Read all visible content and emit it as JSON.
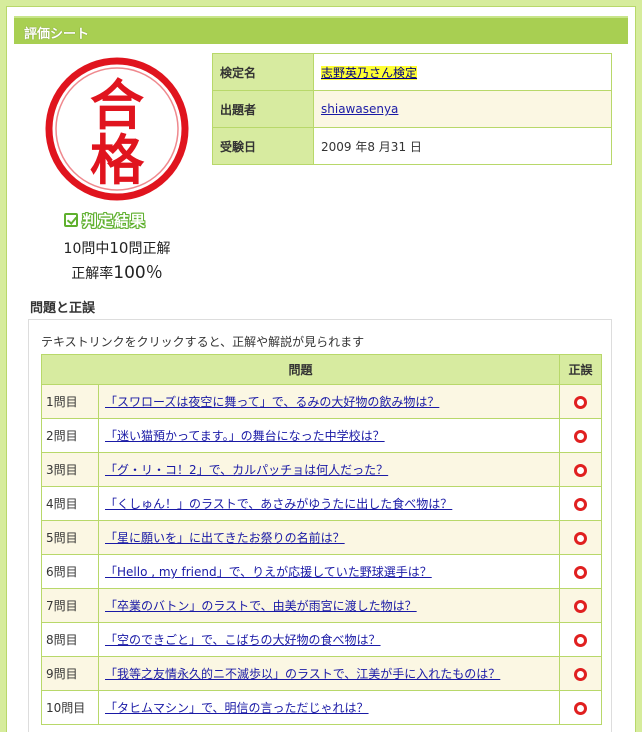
{
  "header": {
    "title": "評価シート"
  },
  "stamp": {
    "line1": "合",
    "line2": "格",
    "color": "#e0141e"
  },
  "result": {
    "label": "判定結果",
    "score_prefix": "10問中",
    "score_correct": "10",
    "score_suffix": "問正解",
    "rate_prefix": "正解率",
    "rate_value": "100％"
  },
  "info": [
    {
      "key": "検定名",
      "value": "志野英乃さん検定"
    },
    {
      "key": "出題者",
      "value": "shiawasenya"
    },
    {
      "key": "受験日",
      "value": "2009 年8 月31 日"
    }
  ],
  "questions_section": {
    "title": "問題と正誤",
    "hint": "テキストリンクをクリックすると、正解や解説が見られます",
    "col_question": "問題",
    "col_result": "正誤"
  },
  "questions": [
    {
      "num": "1問目",
      "text": "「スワローズは夜空に舞って」で、るみの大好物の飲み物は？",
      "correct": true
    },
    {
      "num": "2問目",
      "text": "「迷い猫預かってます。」の舞台になった中学校は？",
      "correct": true
    },
    {
      "num": "3問目",
      "text": "「グ・リ・コ！2」で、カルパッチョは何人だった？",
      "correct": true
    },
    {
      "num": "4問目",
      "text": "「くしゅん！」のラストで、あさみがゆうたに出した食べ物は？",
      "correct": true
    },
    {
      "num": "5問目",
      "text": "「星に願いを」に出てきたお祭りの名前は？",
      "correct": true
    },
    {
      "num": "6問目",
      "text": "「Hello , my friend」で、りえが応援していた野球選手は？",
      "correct": true
    },
    {
      "num": "7問目",
      "text": "「卒業のバトン」のラストで、由美が雨宮に渡した物は？",
      "correct": true
    },
    {
      "num": "8問目",
      "text": "「空のできごと」で、こばちの大好物の食べ物は？",
      "correct": true
    },
    {
      "num": "9問目",
      "text": "「我等之友情永久的ニ不滅歩以」のラストで、江美が手に入れたものは？",
      "correct": true
    },
    {
      "num": "10問目",
      "text": "「タヒムマシン」で、明信の言っただじゃれは？",
      "correct": true
    }
  ]
}
